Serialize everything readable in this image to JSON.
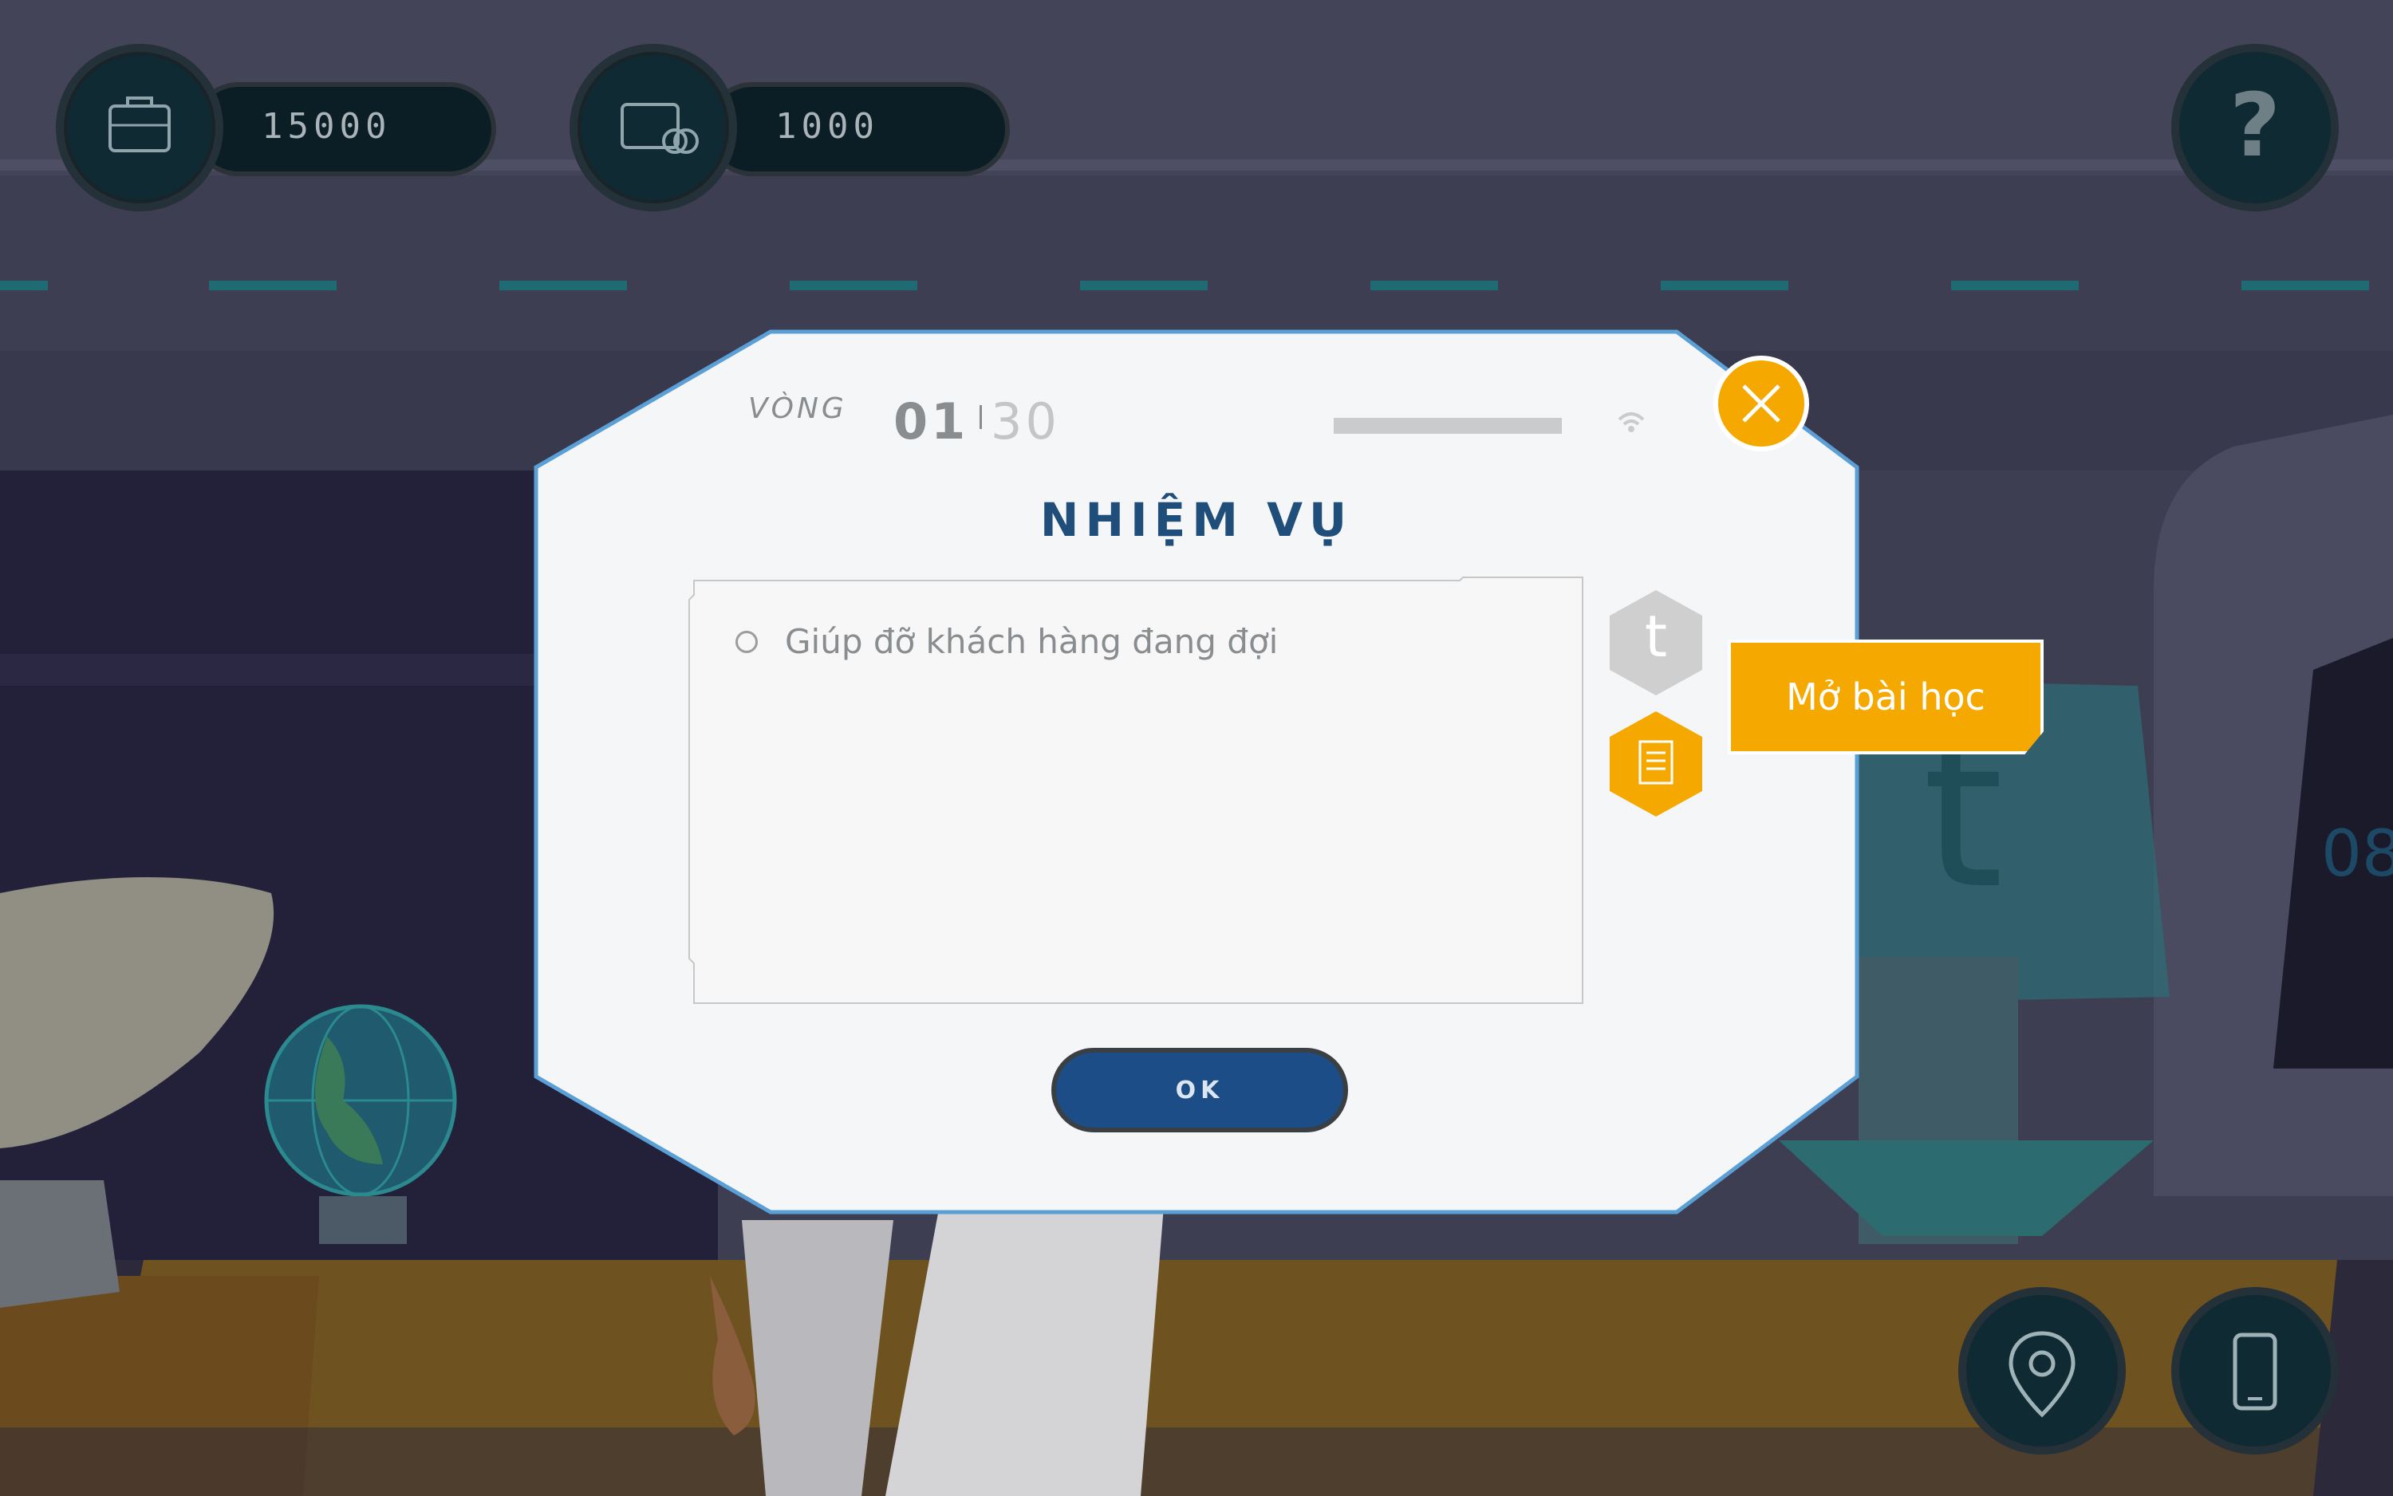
{
  "hud": {
    "money": {
      "icon": "briefcase-icon",
      "value": "15000"
    },
    "wallet": {
      "icon": "wallet-icon",
      "value": "1000"
    },
    "help": {
      "icon": "question-icon"
    },
    "map": {
      "icon": "map-pin-icon"
    },
    "phone": {
      "icon": "phone-icon"
    }
  },
  "dialog": {
    "round_label": "VÒNG",
    "round_current": "01",
    "round_total": "30",
    "title": "NHIỆM VỤ",
    "tasks": [
      {
        "text": "Giúp đỡ khách hàng đang đợi",
        "done": false
      }
    ],
    "side_buttons": [
      {
        "icon": "t-icon",
        "label": "t",
        "color": "#cfcfcf"
      },
      {
        "icon": "document-icon",
        "color": "#f5a900"
      }
    ],
    "ok_label": "OK",
    "close_icon": "close-icon"
  },
  "tooltip": {
    "text": "Mở bài học"
  },
  "colors": {
    "accent": "#f5a900",
    "title": "#1f4e7a",
    "dialog_bg": "#f5f6f7",
    "ok_bg": "#1c4d86"
  }
}
